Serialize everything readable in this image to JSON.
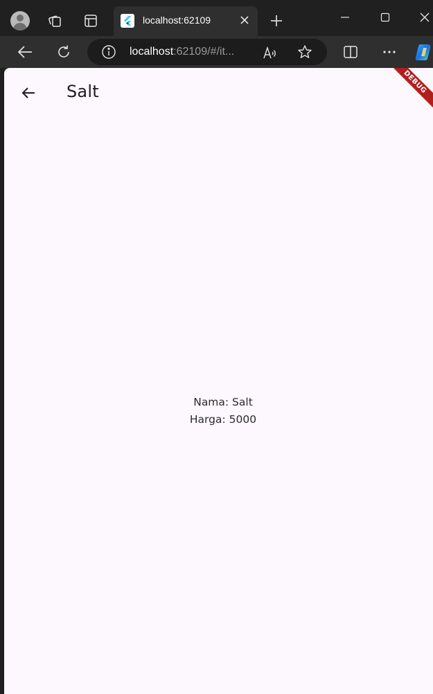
{
  "browser": {
    "tab": {
      "title": "localhost:62109"
    },
    "address": {
      "host": "localhost",
      "path": ":62109/#/it..."
    }
  },
  "app": {
    "title": "Salt",
    "details": {
      "name_line": "Nama: Salt",
      "price_line": "Harga: 5000"
    },
    "debug_banner": "DEBUG"
  },
  "colors": {
    "app_background": "#fdf7fe",
    "chrome_dark": "#202020",
    "chrome_toolbar": "#2f2f2f",
    "debug_banner": "#b11e1e"
  },
  "icons": [
    "profile-avatar-icon",
    "workspaces-icon",
    "tab-actions-icon",
    "flutter-favicon",
    "tab-close-icon",
    "new-tab-icon",
    "minimize-icon",
    "maximize-icon",
    "window-close-icon",
    "back-icon",
    "refresh-icon",
    "site-info-icon",
    "read-aloud-icon",
    "favorite-star-icon",
    "split-screen-icon",
    "more-icon",
    "copilot-icon",
    "arrow-back-icon"
  ]
}
